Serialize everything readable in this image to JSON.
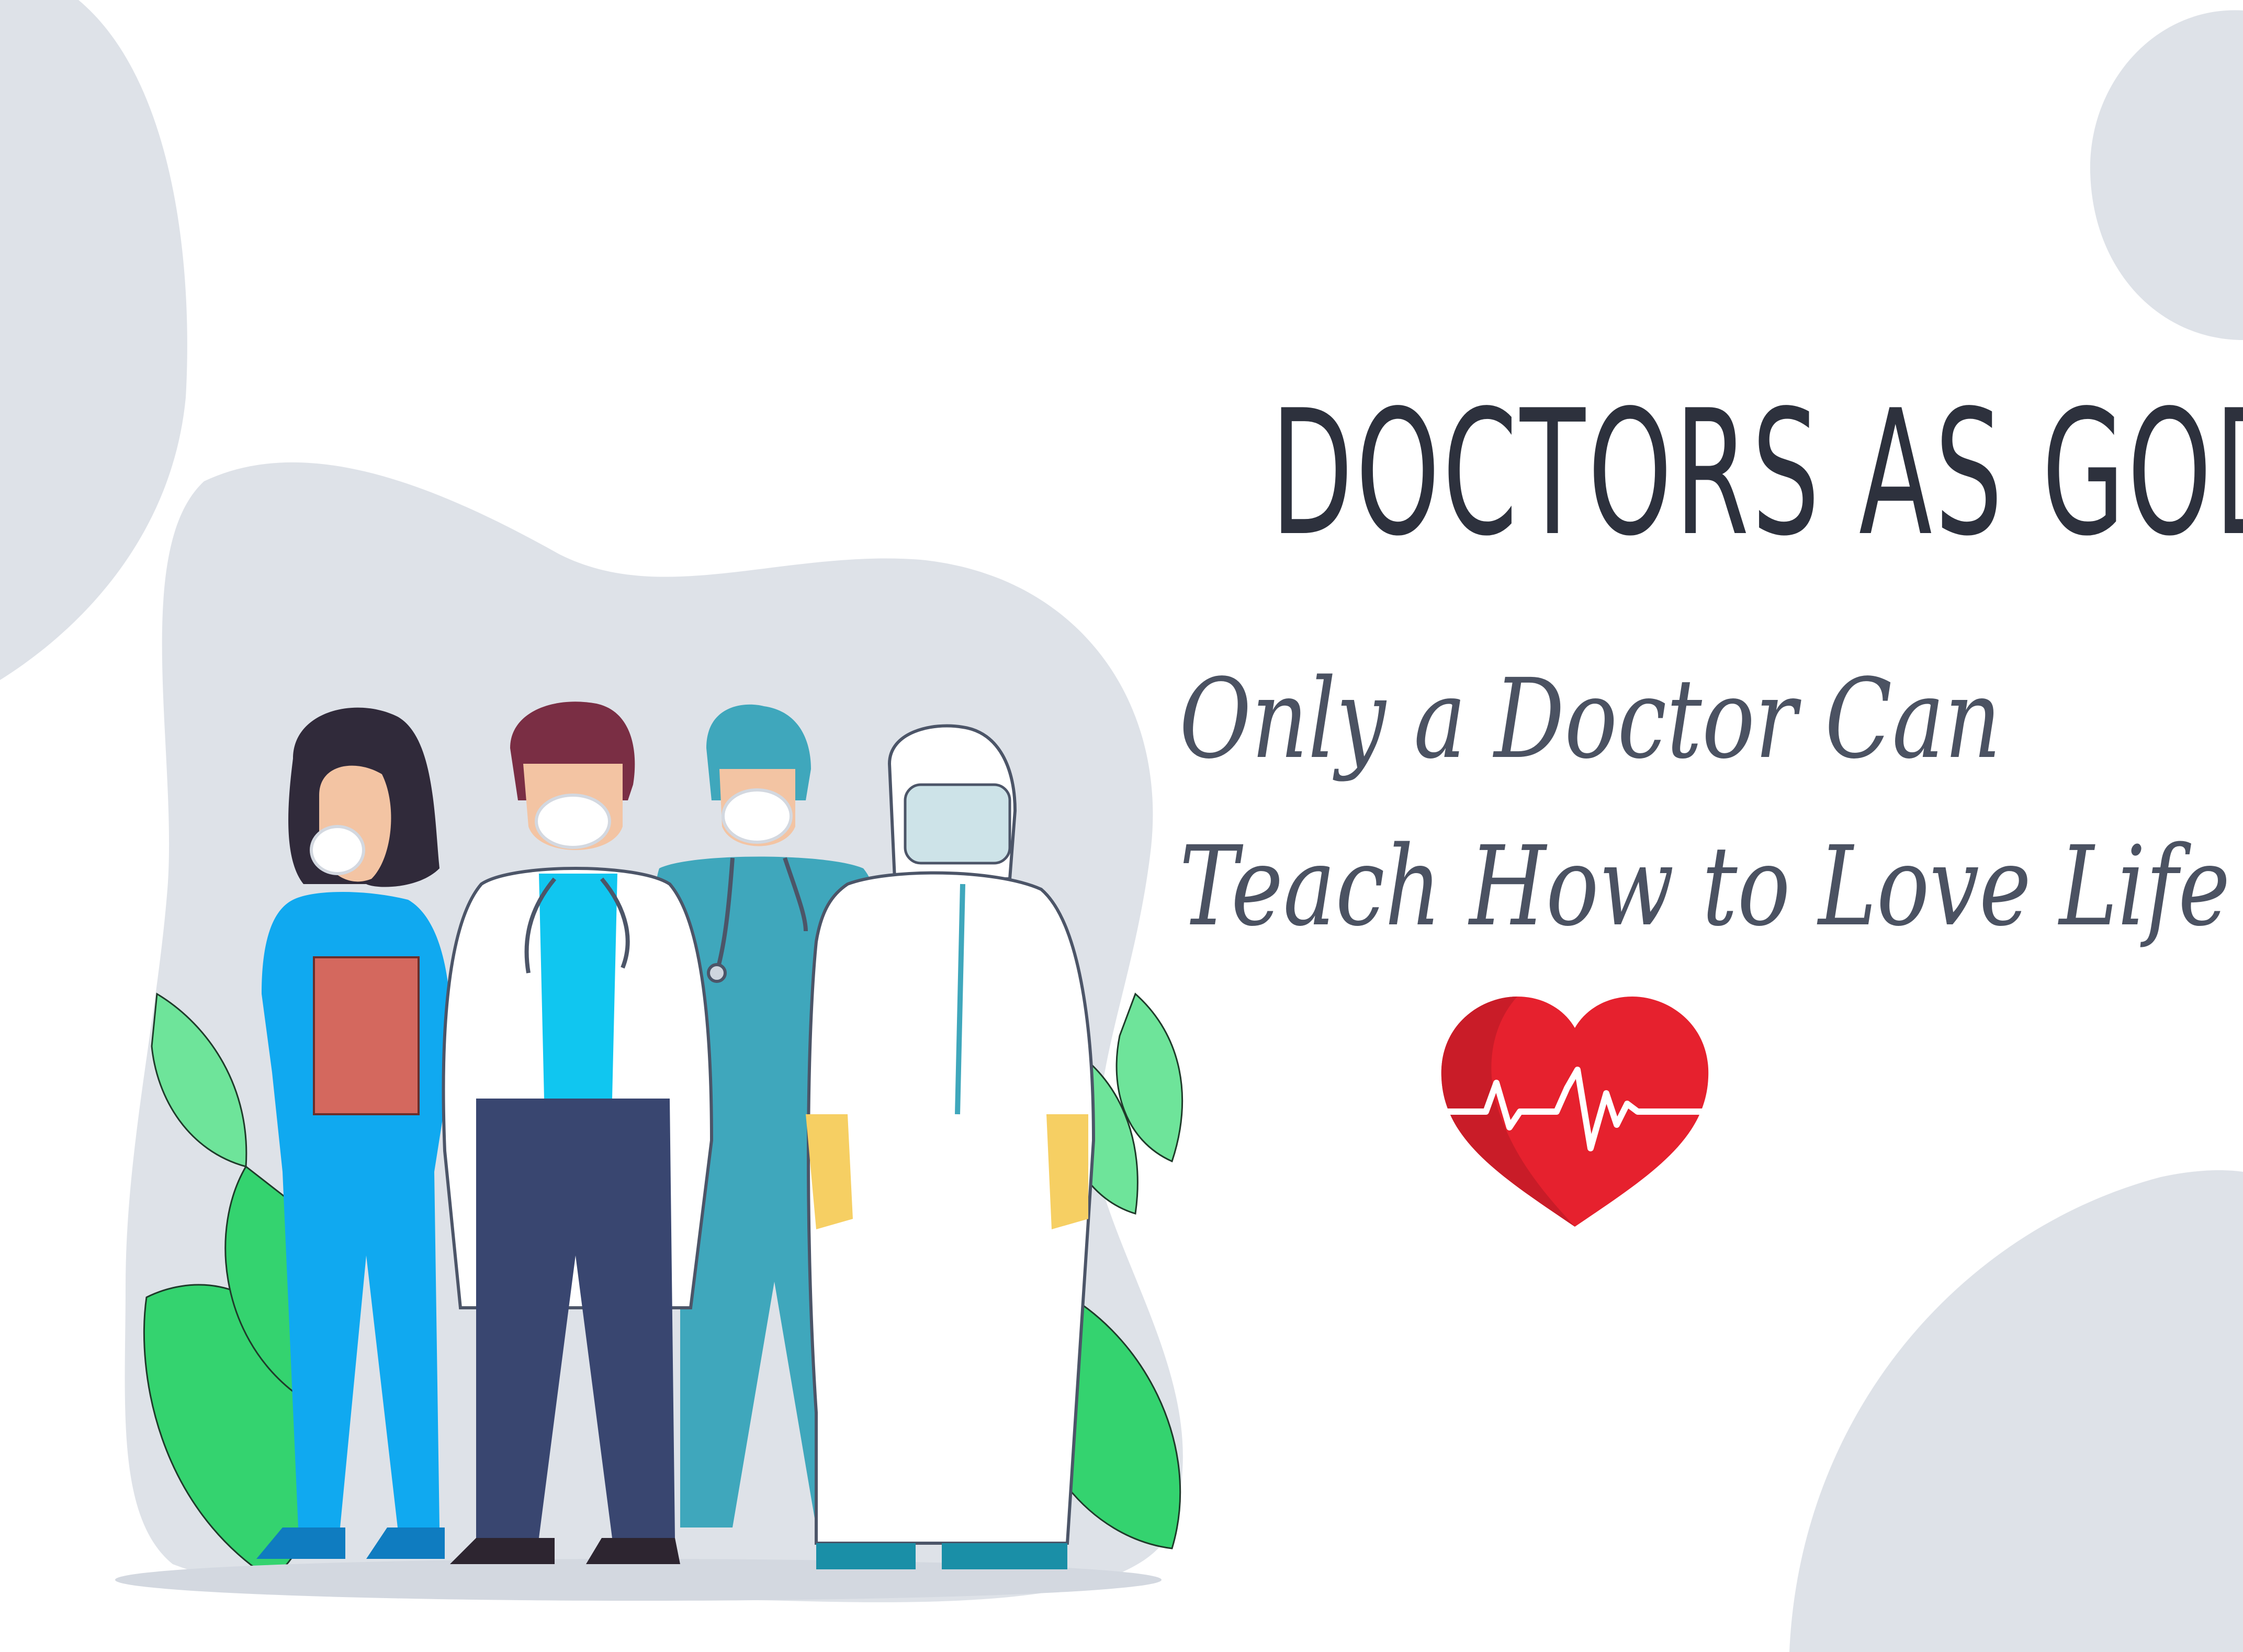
{
  "title": "DOCTORS AS GOD",
  "subtitle_line1": "Only a Doctor Can",
  "subtitle_line2": "Teach How to Love Life",
  "colors": {
    "background": "#ffffff",
    "blob": "#dee2e8",
    "title_text": "#2d313d",
    "subtitle_text": "#4b5262",
    "heart": "#e6212e",
    "heart_dark": "#c91c28",
    "leaf": "#34d36f",
    "leaf_light": "#6ee49a",
    "scrubs_blue": "#10a9f0",
    "scrubs_teal": "#3fa7bc",
    "coat_white": "#ffffff",
    "trousers_navy": "#394670",
    "ppe_gloves": "#f6cf63",
    "clipboard": "#d4685e",
    "hair_dark": "#302a3a",
    "hair_brown": "#7a2e44"
  },
  "icons": [
    "heart-pulse-icon",
    "stethoscope-icon"
  ]
}
